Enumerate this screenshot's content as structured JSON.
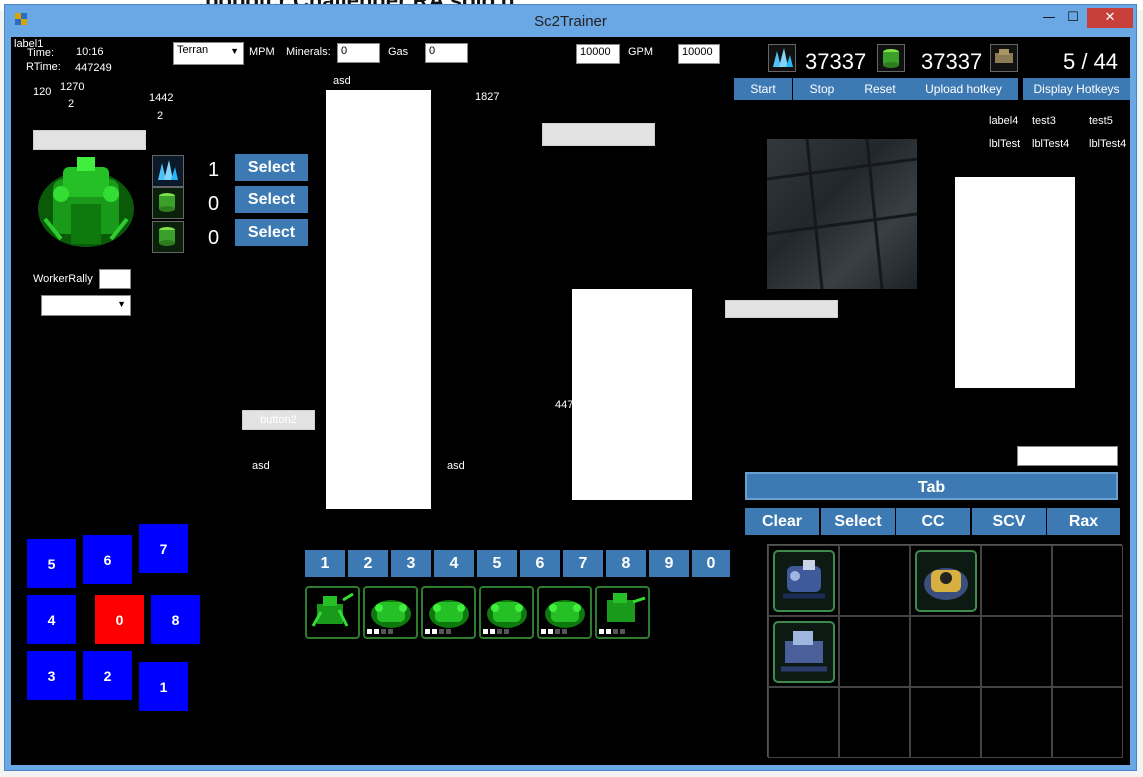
{
  "window": {
    "title": "Sc2Trainer",
    "minimize": "—",
    "maximize": "☐",
    "close": "✕"
  },
  "background": {
    "behind_title": "pobotcr Challenger RA solo q"
  },
  "top": {
    "label1": "label1",
    "time_label": "Time:",
    "time_value": "10:16",
    "rtime_label": "RTime:",
    "rtime_value": "447249",
    "race_select": "Terran",
    "mpm_label": "MPM",
    "minerals_label": "Minerals:",
    "minerals_value": "0",
    "gas_label": "Gas",
    "gas_value": "0",
    "field_10000_a": "10000",
    "gpm_label": "GPM",
    "field_10000_b": "10000"
  },
  "resources": {
    "minerals": "37337",
    "gas": "37337",
    "supply": "5 / 44"
  },
  "action_buttons": {
    "start": "Start",
    "stop": "Stop",
    "reset": "Reset",
    "upload": "Upload hotkey",
    "display": "Display Hotkeys"
  },
  "test_labels": {
    "label4": "label4",
    "test3": "test3",
    "test5": "test5",
    "lblTest": "lblTest",
    "lblTest4_a": "lblTest4",
    "lblTest4_b": "lblTest4"
  },
  "stats": {
    "n120": "120",
    "n1270": "1270",
    "n2_a": "2",
    "n1442": "1442",
    "n2_b": "2",
    "n1827": "1827",
    "n447": "447"
  },
  "asd_labels": {
    "top": "asd",
    "left": "asd",
    "right": "asd"
  },
  "worker": {
    "counts": [
      "1",
      "0",
      "0"
    ],
    "select_label": "Select",
    "rally_label": "WorkerRally"
  },
  "button2": "button2",
  "squares": [
    "5",
    "6",
    "7",
    "4",
    "0",
    "8",
    "3",
    "2",
    "1"
  ],
  "control_groups": [
    "1",
    "2",
    "3",
    "4",
    "5",
    "6",
    "7",
    "8",
    "9",
    "0"
  ],
  "right_panel": {
    "tab": "Tab",
    "clear": "Clear",
    "select": "Select",
    "cc": "CC",
    "scv": "SCV",
    "rax": "Rax"
  },
  "colors": {
    "accent_blue": "#3d7ab3",
    "hotkey_blue": "#0000ff",
    "hotkey_red": "#ff0000",
    "unit_green": "#22dd22"
  },
  "icons": [
    "mineral-icon",
    "gas-icon",
    "supply-icon",
    "command-center-icon",
    "scv-portrait-icon",
    "barracks-portrait-icon"
  ]
}
